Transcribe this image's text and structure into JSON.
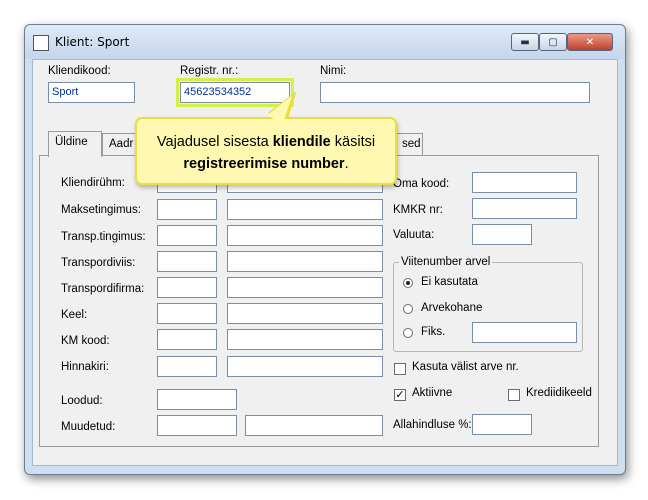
{
  "window": {
    "title": "Klient: Sport",
    "min_glyph": "▬",
    "max_glyph": "▢",
    "close_glyph": "✕"
  },
  "header": {
    "kliendikood_label": "Kliendikood:",
    "kliendikood_value": "Sport",
    "regnr_label": "Registr. nr.:",
    "regnr_value": "45623534352",
    "nimi_label": "Nimi:",
    "nimi_value": ""
  },
  "tabs": [
    {
      "label": "Üldine",
      "active": true
    },
    {
      "label": "Aadr",
      "active": false
    },
    {
      "label": "sed",
      "active": false
    }
  ],
  "left_form": {
    "labels": [
      "Kliendirühm:",
      "Maksetingimus:",
      "Transp.tingimus:",
      "Transpordiviis:",
      "Transpordifirma:",
      "Keel:",
      "KM kood:",
      "Hinnakiri:",
      "Loodud:",
      "Muudetud:"
    ]
  },
  "right_form": {
    "oma_kood_label": "Oma kood:",
    "kmkr_label": "KMKR nr:",
    "valuuta_label": "Valuuta:",
    "viitenumber_group": "Viitenumber arvel",
    "radio_options": [
      {
        "label": "Ei kasutata",
        "selected": true
      },
      {
        "label": "Arvekohane",
        "selected": false
      },
      {
        "label": "Fiks.",
        "selected": false
      }
    ],
    "kasuta_label": "Kasuta välist arve nr.",
    "kasuta_checked": false,
    "aktiivne_label": "Aktiivne",
    "aktiivne_checked": true,
    "krediidikeeld_label": "Krediidikeeld",
    "krediidikeeld_checked": false,
    "allahindlus_label": "Allahindluse %:",
    "check_glyph": "✓"
  },
  "callout": {
    "line1_pre": "Vajadusel sisesta ",
    "line1_bold": "kliendile",
    "line1_post": " käsitsi",
    "line2_bold": "registreerimise number",
    "line2_post": "."
  },
  "colors": {
    "highlight": "#d7ef44",
    "callout_bg": "#fef8b0",
    "callout_border": "#e8df3a",
    "value_text": "#0030a0"
  }
}
